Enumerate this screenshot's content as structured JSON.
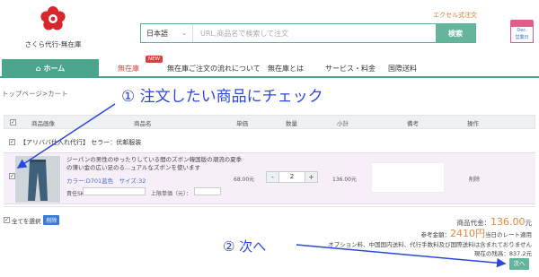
{
  "header": {
    "logo_text": "さくら代行-無在庫",
    "excel_link": "エクセル式注文",
    "search": {
      "language": "日本語",
      "placeholder": "URL,商品名で検索して注文",
      "button": "検索"
    },
    "calendar": {
      "line1": "Dec.",
      "line2": "営業日"
    }
  },
  "nav": {
    "home": "ホーム",
    "items": [
      "無在庫",
      "無在庫ご注文の流れについて",
      "無在庫とは",
      "サービス・料金",
      "国際送料"
    ],
    "new_badge": "NEW"
  },
  "breadcrumb": "トップページ>カート",
  "annotations": {
    "step1": "① 注文したい商品にチェック",
    "step2": "② 次へ"
  },
  "table": {
    "headers": [
      "商品画像",
      "商品名",
      "単価",
      "数量",
      "小計",
      "備考",
      "操作"
    ],
    "seller": "【アリババ仕入れ代行】 セラー：优邮服装",
    "item": {
      "title": "ジーパンの男性のゆったりしている間のズボン韓国版の潮流の夏季の薄い金の広い足のる...ュアルなズボンを使います",
      "variant": "カラー:D701蓝色　サイズ:32",
      "memo_label": "責任SKU：",
      "limit_label": "上限単価（元）：",
      "unit_price": "68.00元",
      "quantity": "2",
      "minus": "-",
      "plus": "+",
      "subtotal": "136.00元",
      "delete": "削除"
    }
  },
  "footer": {
    "select_all": "全てを選択",
    "delete_btn": "削除",
    "goods_total_label": "商品代金：",
    "goods_total_value": "136.00",
    "goods_total_unit": "元",
    "yen_label": "参考金額：",
    "yen_value": "2410円",
    "yen_note": "当日のレート適用",
    "fee_note": "オプション料、中国国内送料、代行手数料及び国際送料は含まれておりません",
    "balance": "現在の残高：837.2元",
    "next_button": "次へ"
  },
  "colors": {
    "accent": "#4aa58c",
    "annotation": "#2b47e0",
    "price": "#e8863a",
    "highlight_row": "#f7eff8"
  }
}
